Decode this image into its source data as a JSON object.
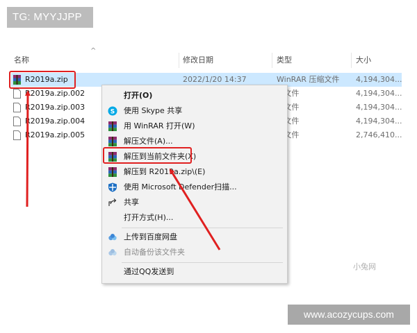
{
  "watermark_top": "TG: MYYJJPP",
  "watermark_bottom": "www.acozycups.com",
  "watermark_corner": "小兔网",
  "columns": {
    "name": "名称",
    "date": "修改日期",
    "type": "类型",
    "size": "大小"
  },
  "files": [
    {
      "name": "R2019a.zip",
      "date": "2022/1/20 14:37",
      "type": "WinRAR 压缩文件",
      "size": "4,194,304...",
      "selected": true
    },
    {
      "name": "R2019a.zip.002",
      "date": "",
      "type": "2 文件",
      "size": "4,194,304..."
    },
    {
      "name": "R2019a.zip.003",
      "date": "",
      "type": "3 文件",
      "size": "4,194,304..."
    },
    {
      "name": "R2019a.zip.004",
      "date": "",
      "type": "4 文件",
      "size": "4,194,304..."
    },
    {
      "name": "R2019a.zip.005",
      "date": "",
      "type": "5 文件",
      "size": "2,746,410..."
    }
  ],
  "menu": {
    "open": "打开(O)",
    "skype": "使用 Skype 共享",
    "winrar_open": "用 WinRAR 打开(W)",
    "extract_files": "解压文件(A)...",
    "extract_here": "解压到当前文件夹(X)",
    "extract_to": "解压到 R2019a.zip\\(E)",
    "defender": "使用 Microsoft Defender扫描...",
    "share": "共享",
    "open_with": "打开方式(H)...",
    "baidu_upload": "上传到百度网盘",
    "baidu_backup": "自动备份该文件夹",
    "qq_send": "通过QQ发送到"
  },
  "colors": {
    "highlight": "#e02020",
    "selection": "#cce8ff",
    "menu_bg": "#f2f2f2"
  }
}
